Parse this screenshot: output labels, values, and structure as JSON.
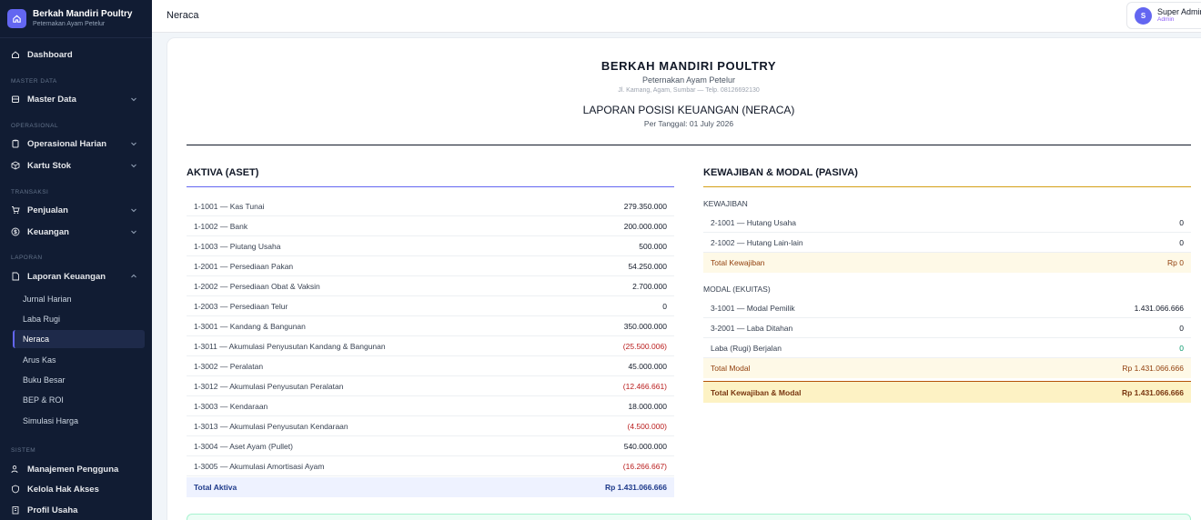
{
  "brand": {
    "title": "Berkah Mandiri Poultry",
    "subtitle": "Peternakan Ayam Petelur"
  },
  "sidebar": {
    "dashboard": "Dashboard",
    "sections": {
      "master": "MASTER DATA",
      "operasional": "OPERASIONAL",
      "transaksi": "TRANSAKSI",
      "laporan": "LAPORAN",
      "sistem": "SISTEM"
    },
    "items": {
      "master_data": "Master Data",
      "operasional_harian": "Operasional Harian",
      "kartu_stok": "Kartu Stok",
      "penjualan": "Penjualan",
      "keuangan": "Keuangan",
      "laporan_keuangan": "Laporan Keuangan",
      "manajemen_pengguna": "Manajemen Pengguna",
      "kelola_hak_akses": "Kelola Hak Akses",
      "profil_usaha": "Profil Usaha"
    },
    "sub_items": [
      "Jurnal Harian",
      "Laba Rugi",
      "Neraca",
      "Arus Kas",
      "Buku Besar",
      "BEP & ROI",
      "Simulasi Harga"
    ],
    "active_sub": "Neraca"
  },
  "topbar": {
    "title": "Neraca",
    "user_name": "Super Admin",
    "user_role": "Admin",
    "avatar_initial": "S"
  },
  "report": {
    "company": "BERKAH MANDIRI POULTRY",
    "company_sub": "Peternakan Ayam Petelur",
    "address": "Jl. Kamang, Agam, Sumbar — Telp. 08126692130",
    "title": "LAPORAN POSISI KEUANGAN (NERACA)",
    "date": "Per Tanggal: 01 July 2026"
  },
  "aktiva": {
    "title": "AKTIVA (ASET)",
    "rows": [
      {
        "label": "1-1001 — Kas Tunai",
        "value": "279.350.000",
        "neg": false
      },
      {
        "label": "1-1002 — Bank",
        "value": "200.000.000",
        "neg": false
      },
      {
        "label": "1-1003 — Piutang Usaha",
        "value": "500.000",
        "neg": false
      },
      {
        "label": "1-2001 — Persediaan Pakan",
        "value": "54.250.000",
        "neg": false
      },
      {
        "label": "1-2002 — Persediaan Obat & Vaksin",
        "value": "2.700.000",
        "neg": false
      },
      {
        "label": "1-2003 — Persediaan Telur",
        "value": "0",
        "neg": false
      },
      {
        "label": "1-3001 — Kandang & Bangunan",
        "value": "350.000.000",
        "neg": false
      },
      {
        "label": "1-3011 — Akumulasi Penyusutan Kandang & Bangunan",
        "value": "(25.500.006)",
        "neg": true
      },
      {
        "label": "1-3002 — Peralatan",
        "value": "45.000.000",
        "neg": false
      },
      {
        "label": "1-3012 — Akumulasi Penyusutan Peralatan",
        "value": "(12.466.661)",
        "neg": true
      },
      {
        "label": "1-3003 — Kendaraan",
        "value": "18.000.000",
        "neg": false
      },
      {
        "label": "1-3013 — Akumulasi Penyusutan Kendaraan",
        "value": "(4.500.000)",
        "neg": true
      },
      {
        "label": "1-3004 — Aset Ayam (Pullet)",
        "value": "540.000.000",
        "neg": false
      },
      {
        "label": "1-3005 — Akumulasi Amortisasi Ayam",
        "value": "(16.266.667)",
        "neg": true
      }
    ],
    "total_label": "Total Aktiva",
    "total_value": "Rp 1.431.066.666"
  },
  "pasiva": {
    "title": "KEWAJIBAN & MODAL (PASIVA)",
    "kewajiban_label": "KEWAJIBAN",
    "kewajiban_rows": [
      {
        "label": "2-1001 — Hutang Usaha",
        "value": "0"
      },
      {
        "label": "2-1002 — Hutang Lain-lain",
        "value": "0"
      }
    ],
    "total_kewajiban_label": "Total Kewajiban",
    "total_kewajiban_value": "Rp 0",
    "modal_label": "MODAL (EKUITAS)",
    "modal_rows": [
      {
        "label": "3-1001 — Modal Pemilik",
        "value": "1.431.066.666"
      },
      {
        "label": "3-2001 — Laba Ditahan",
        "value": "0"
      },
      {
        "label": "Laba (Rugi) Berjalan",
        "value": "0"
      }
    ],
    "total_modal_label": "Total Modal",
    "total_modal_value": "Rp 1.431.066.666",
    "grand_label": "Total Kewajiban & Modal",
    "grand_value": "Rp 1.431.066.666"
  },
  "colors": {
    "sidebar": "#111c33",
    "accent": "#6366f1",
    "negative": "#b91c1c",
    "positive": "#059669",
    "subtotal_bg": "#fef9e7"
  }
}
